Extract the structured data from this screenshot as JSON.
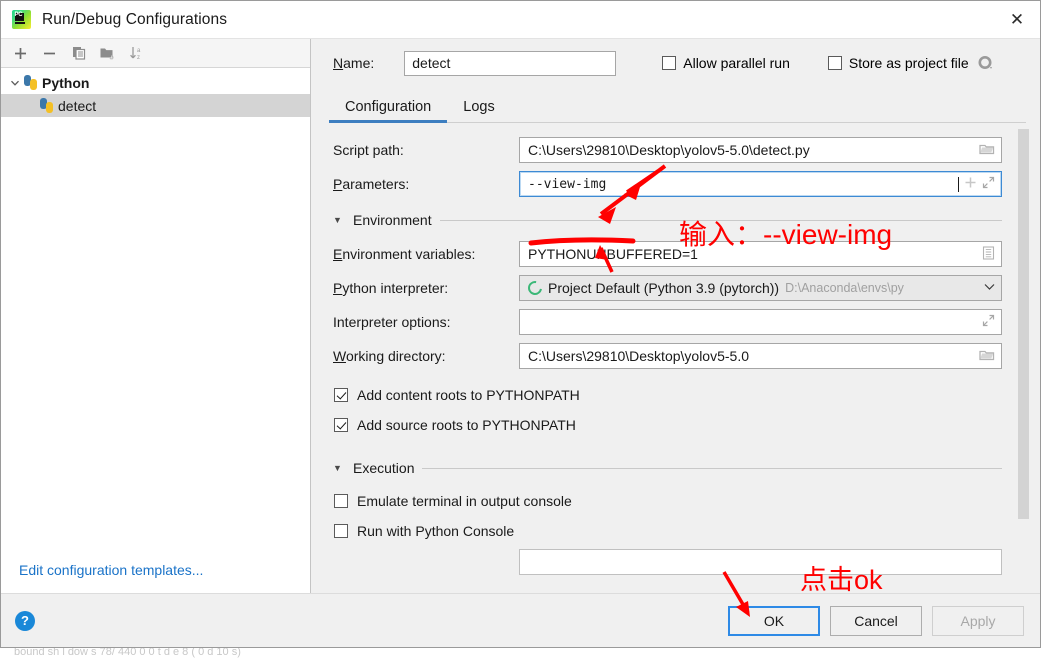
{
  "window": {
    "title": "Run/Debug Configurations",
    "app_icon": "pycharm-icon",
    "close_label": "✕"
  },
  "sidebar": {
    "toolbar": [
      {
        "name": "add-configuration-button",
        "icon": "plus-icon",
        "label": "+"
      },
      {
        "name": "remove-configuration-button",
        "icon": "minus-icon",
        "label": "−"
      },
      {
        "name": "copy-configuration-button",
        "icon": "copy-icon",
        "label": "Copy"
      },
      {
        "name": "new-folder-button",
        "icon": "new-folder-icon",
        "label": "New Folder"
      },
      {
        "name": "sort-configurations-button",
        "icon": "sort-alphabetical-icon",
        "label": "Sort"
      }
    ],
    "tree": [
      {
        "label": "Python",
        "icon": "python-icon",
        "expanded": true,
        "selected": false,
        "level": 0
      },
      {
        "label": "detect",
        "icon": "python-icon",
        "expanded": false,
        "selected": true,
        "level": 1
      }
    ],
    "edit_templates_link": "Edit configuration templates..."
  },
  "header": {
    "name_label": "Name:",
    "name_value": "detect",
    "allow_parallel_run": {
      "label": "Allow parallel run",
      "checked": false
    },
    "store_as_project_file": {
      "label": "Store as project file",
      "checked": false
    },
    "gear_icon": "gear-icon"
  },
  "tabs": [
    {
      "label": "Configuration",
      "active": true
    },
    {
      "label": "Logs",
      "active": false
    }
  ],
  "form": {
    "script_path": {
      "label": "Script path:",
      "value": "C:\\Users\\29810\\Desktop\\yolov5-5.0\\detect.py",
      "icon": "folder-icon"
    },
    "parameters": {
      "label": "Parameters:",
      "value": "--view-img",
      "focused": true,
      "icons": [
        "plus-icon",
        "expand-icon"
      ]
    },
    "environment_section": "Environment",
    "environment_variables": {
      "label": "Environment variables:",
      "value": "PYTHONUNBUFFERED=1",
      "icon": "list-edit-icon"
    },
    "python_interpreter": {
      "label": "Python interpreter:",
      "value": "Project Default (Python 3.9 (pytorch))",
      "path_hint": "D:\\Anaconda\\envs\\py",
      "icon": "python-env-icon",
      "chevron": "chevron-down-icon"
    },
    "interpreter_options": {
      "label": "Interpreter options:",
      "value": "",
      "icon": "expand-icon"
    },
    "working_directory": {
      "label": "Working directory:",
      "value": "C:\\Users\\29810\\Desktop\\yolov5-5.0",
      "icon": "folder-icon"
    },
    "add_content_roots": {
      "label": "Add content roots to PYTHONPATH",
      "checked": true
    },
    "add_source_roots": {
      "label": "Add source roots to PYTHONPATH",
      "checked": true
    },
    "execution_section": "Execution",
    "emulate_terminal": {
      "label": "Emulate terminal in output console",
      "checked": false
    },
    "run_with_python_console": {
      "label": "Run with Python Console",
      "checked": false
    }
  },
  "footer": {
    "help_label": "?",
    "ok": "OK",
    "cancel": "Cancel",
    "apply": "Apply",
    "apply_disabled": true
  },
  "annotations": {
    "color": "#ff0000",
    "input_hint": "输入：--view-img",
    "ok_hint": "点击ok"
  },
  "background_sliver": "bound sh  l  dow  s 78/ 440 0            0  t d      e  8   ( 0  d 10 s)"
}
